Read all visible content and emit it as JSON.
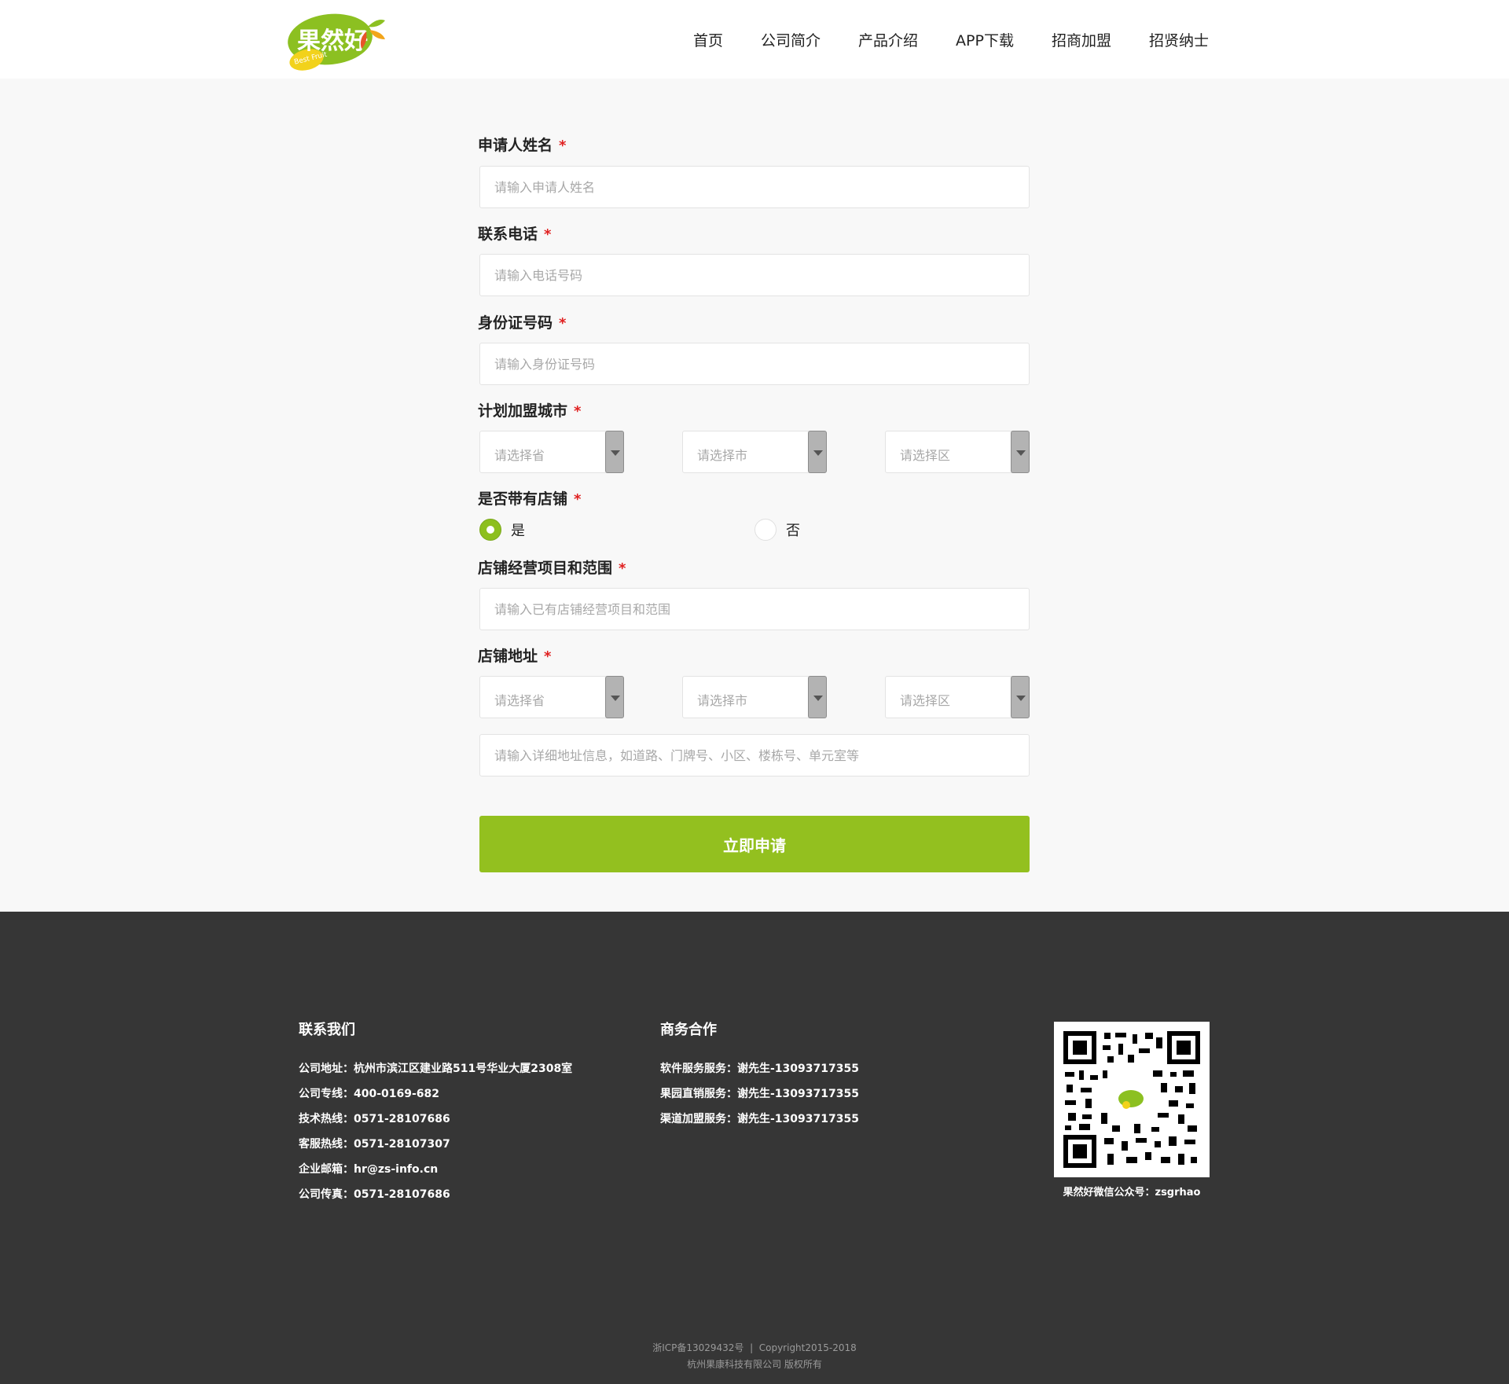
{
  "brand": {
    "logo_text": "果然好",
    "logo_sub": "Best Fruit",
    "accent": "#93c01f"
  },
  "nav": [
    "首页",
    "公司简介",
    "产品介绍",
    "APP下载",
    "招商加盟",
    "招贤纳士"
  ],
  "form": {
    "required_mark": "*",
    "name": {
      "label": "申请人姓名",
      "placeholder": "请输入申请人姓名"
    },
    "phone": {
      "label": "联系电话",
      "placeholder": "请输入电话号码"
    },
    "id": {
      "label": "身份证号码",
      "placeholder": "请输入身份证号码"
    },
    "city": {
      "label": "计划加盟城市",
      "province": "请选择省",
      "city": "请选择市",
      "district": "请选择区"
    },
    "has_shop": {
      "label": "是否带有店铺",
      "yes": "是",
      "no": "否",
      "selected": "是"
    },
    "scope": {
      "label": "店铺经营项目和范围",
      "placeholder": "请输入已有店铺经营项目和范围"
    },
    "address": {
      "label": "店铺地址",
      "province": "请选择省",
      "city": "请选择市",
      "district": "请选择区",
      "placeholder": "请输入详细地址信息，如道路、门牌号、小区、楼栋号、单元室等"
    },
    "submit": "立即申请"
  },
  "footer": {
    "contact": {
      "title": "联系我们",
      "lines": [
        "公司地址：杭州市滨江区建业路511号华业大厦2308室",
        "公司专线：400-0169-682",
        "技术热线：0571-28107686",
        "客服热线：0571-28107307",
        "企业邮箱：hr@zs-info.cn",
        "公司传真：0571-28107686"
      ]
    },
    "business": {
      "title": "商务合作",
      "lines": [
        "软件服务服务：谢先生-13093717355",
        "果园直销服务：谢先生-13093717355",
        "渠道加盟服务：谢先生-13093717355"
      ]
    },
    "qr_caption": "果然好微信公众号：zsgrhao",
    "copyright_1": "浙ICP备13029432号  |  Copyright2015-2018",
    "copyright_2": "杭州果康科技有限公司 版权所有"
  }
}
